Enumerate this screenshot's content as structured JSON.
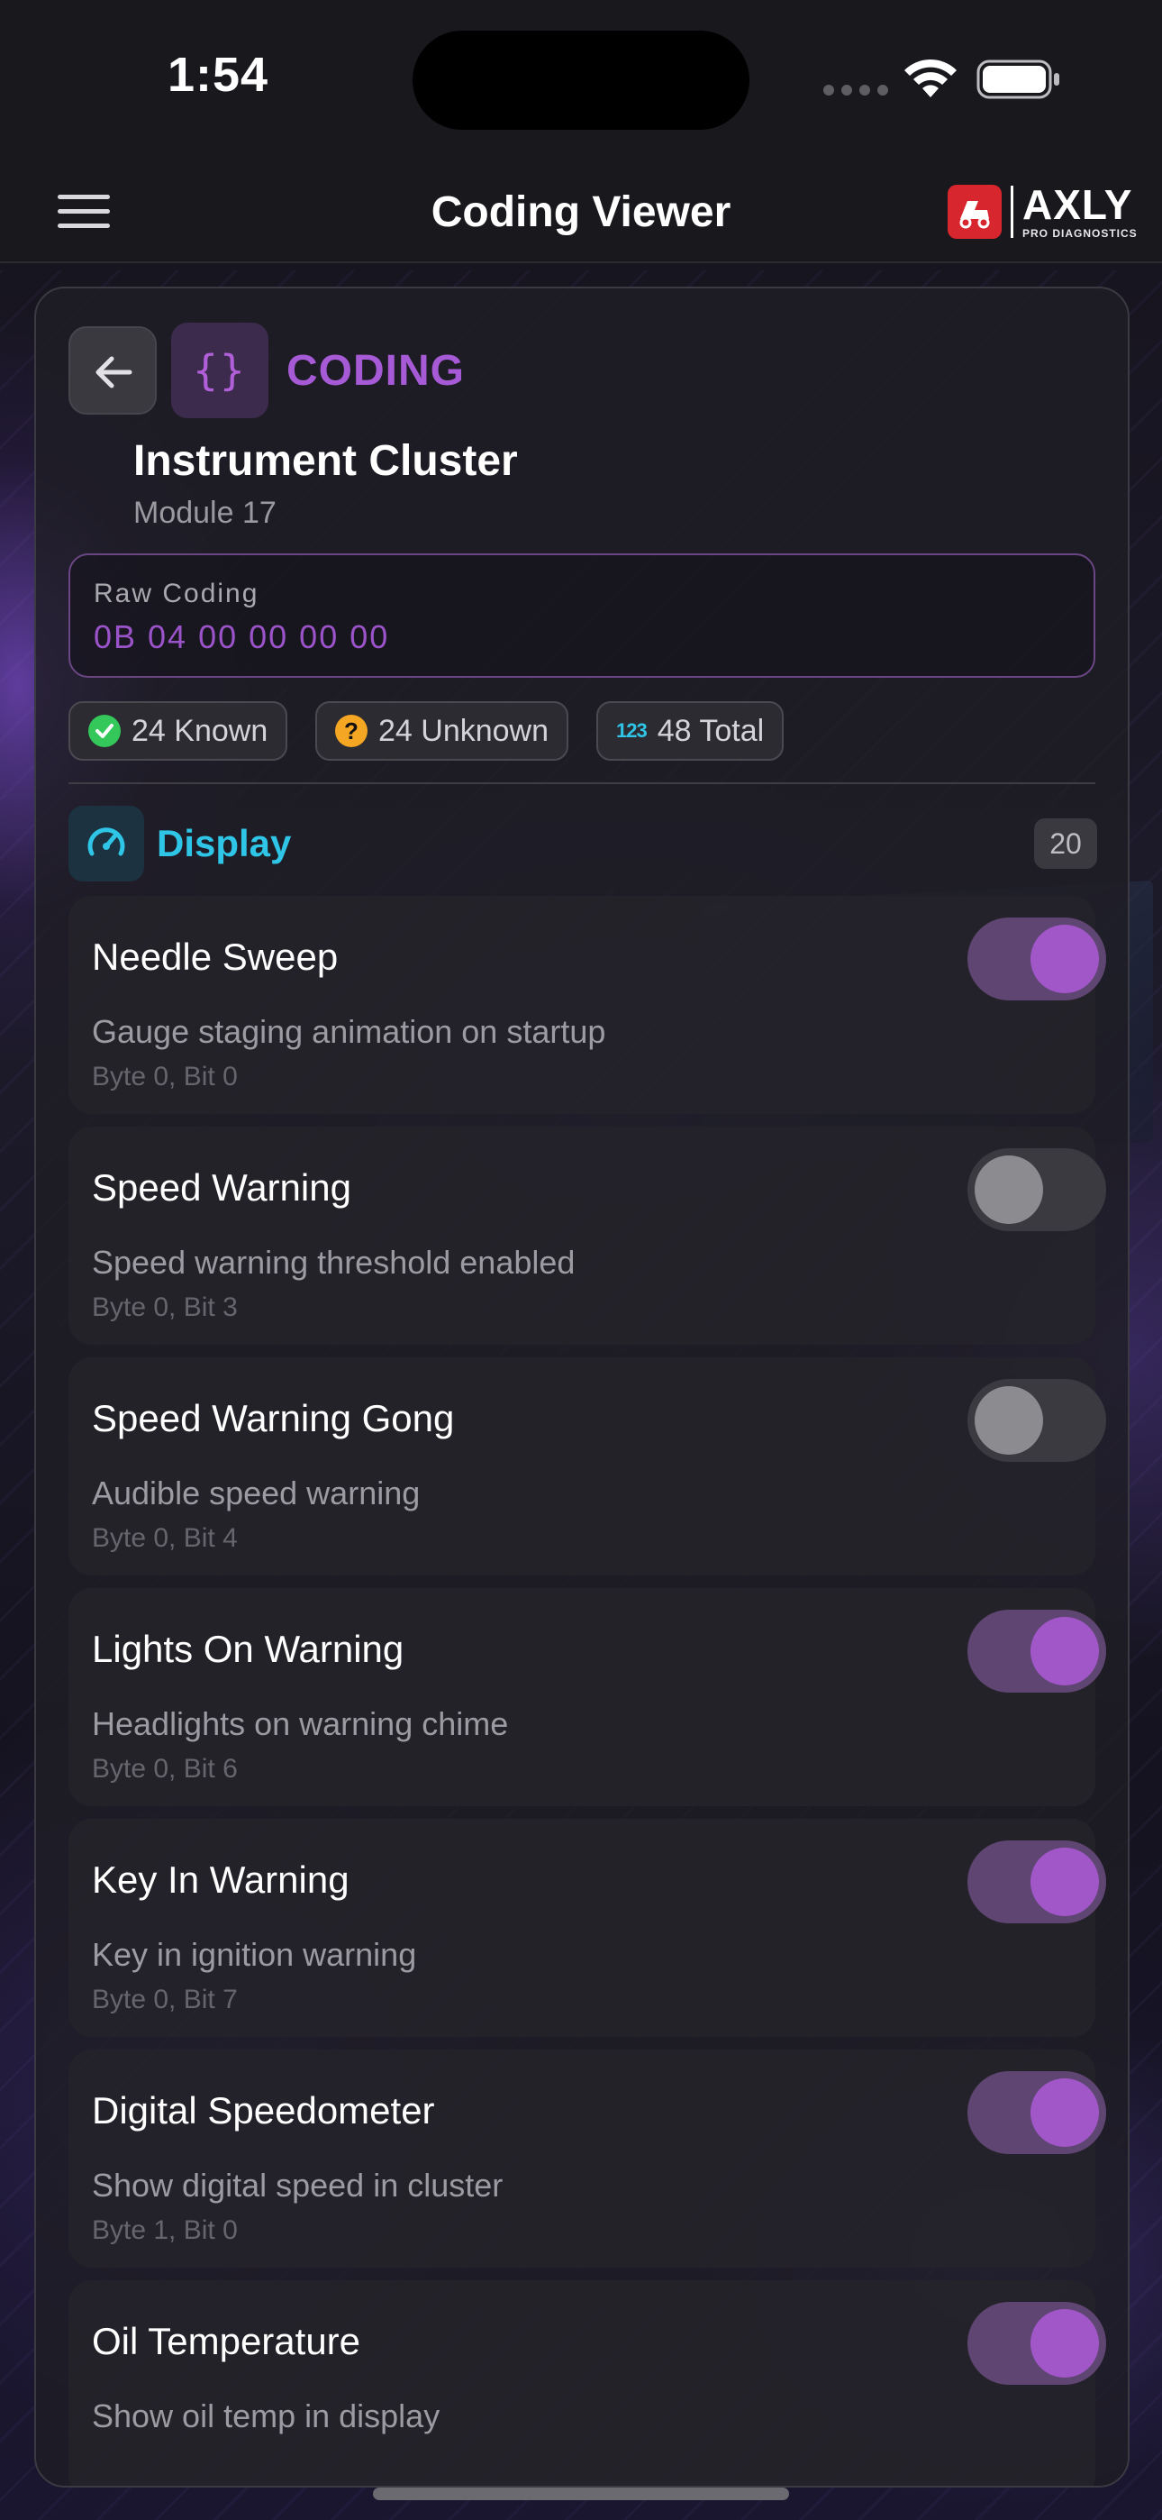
{
  "status_bar": {
    "time": "1:54"
  },
  "header": {
    "title": "Coding Viewer",
    "logo_name": "AXLY",
    "logo_sub": "PRO DIAGNOSTICS"
  },
  "coding": {
    "section_label": "CODING",
    "icon_glyph": "{}",
    "module_name": "Instrument Cluster",
    "module_sub": "Module 17",
    "raw_label": "Raw Coding",
    "raw_value": "0B 04 00 00 00 00",
    "stats": {
      "known": "24 Known",
      "unknown": "24 Unknown",
      "total_icon": "123",
      "total": "48 Total"
    }
  },
  "group": {
    "title": "Display",
    "count": "20",
    "items": [
      {
        "title": "Needle Sweep",
        "desc": "Gauge staging animation on startup",
        "meta": "Byte 0, Bit 0",
        "enabled": true
      },
      {
        "title": "Speed Warning",
        "desc": "Speed warning threshold enabled",
        "meta": "Byte 0, Bit 3",
        "enabled": false
      },
      {
        "title": "Speed Warning Gong",
        "desc": "Audible speed warning",
        "meta": "Byte 0, Bit 4",
        "enabled": false
      },
      {
        "title": "Lights On Warning",
        "desc": "Headlights on warning chime",
        "meta": "Byte 0, Bit 6",
        "enabled": true
      },
      {
        "title": "Key In Warning",
        "desc": "Key in ignition warning",
        "meta": "Byte 0, Bit 7",
        "enabled": true
      },
      {
        "title": "Digital Speedometer",
        "desc": "Show digital speed in cluster",
        "meta": "Byte 1, Bit 0",
        "enabled": true
      },
      {
        "title": "Oil Temperature",
        "desc": "Show oil temp in display",
        "meta": "",
        "enabled": true
      }
    ]
  },
  "colors": {
    "accent_purple": "#a257c9",
    "accent_cyan": "#2ec5e6",
    "known_green": "#34c759",
    "unknown_orange": "#f5a623",
    "brand_red": "#d7262e"
  }
}
